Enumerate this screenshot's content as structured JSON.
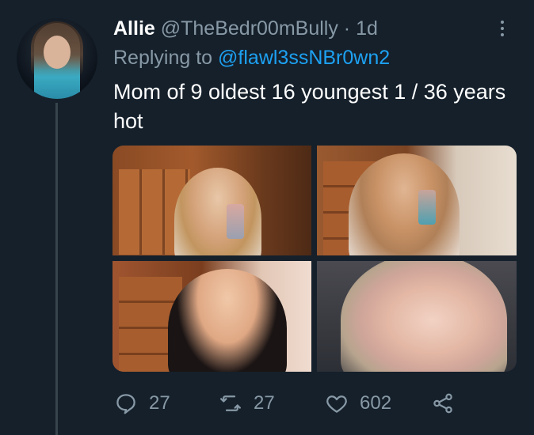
{
  "tweet": {
    "author_name": "Allie",
    "author_handle": "@TheBedr00mBully",
    "separator": "·",
    "time": "1d",
    "replying_prefix": "Replying to",
    "replying_to": "@flawl3ssNBr0wn2",
    "text": "Mom of 9 oldest 16 youngest 1 / 36 years hot",
    "media_count": 4
  },
  "actions": {
    "replies": "27",
    "retweets": "27",
    "likes": "602"
  },
  "icons": {
    "more": "more-vertical-icon",
    "reply": "reply-icon",
    "retweet": "retweet-icon",
    "like": "heart-icon",
    "share": "share-icon"
  },
  "colors": {
    "background": "#15202b",
    "secondary_text": "#8899a6",
    "link": "#1da1f2",
    "thread_line": "#38444d"
  }
}
